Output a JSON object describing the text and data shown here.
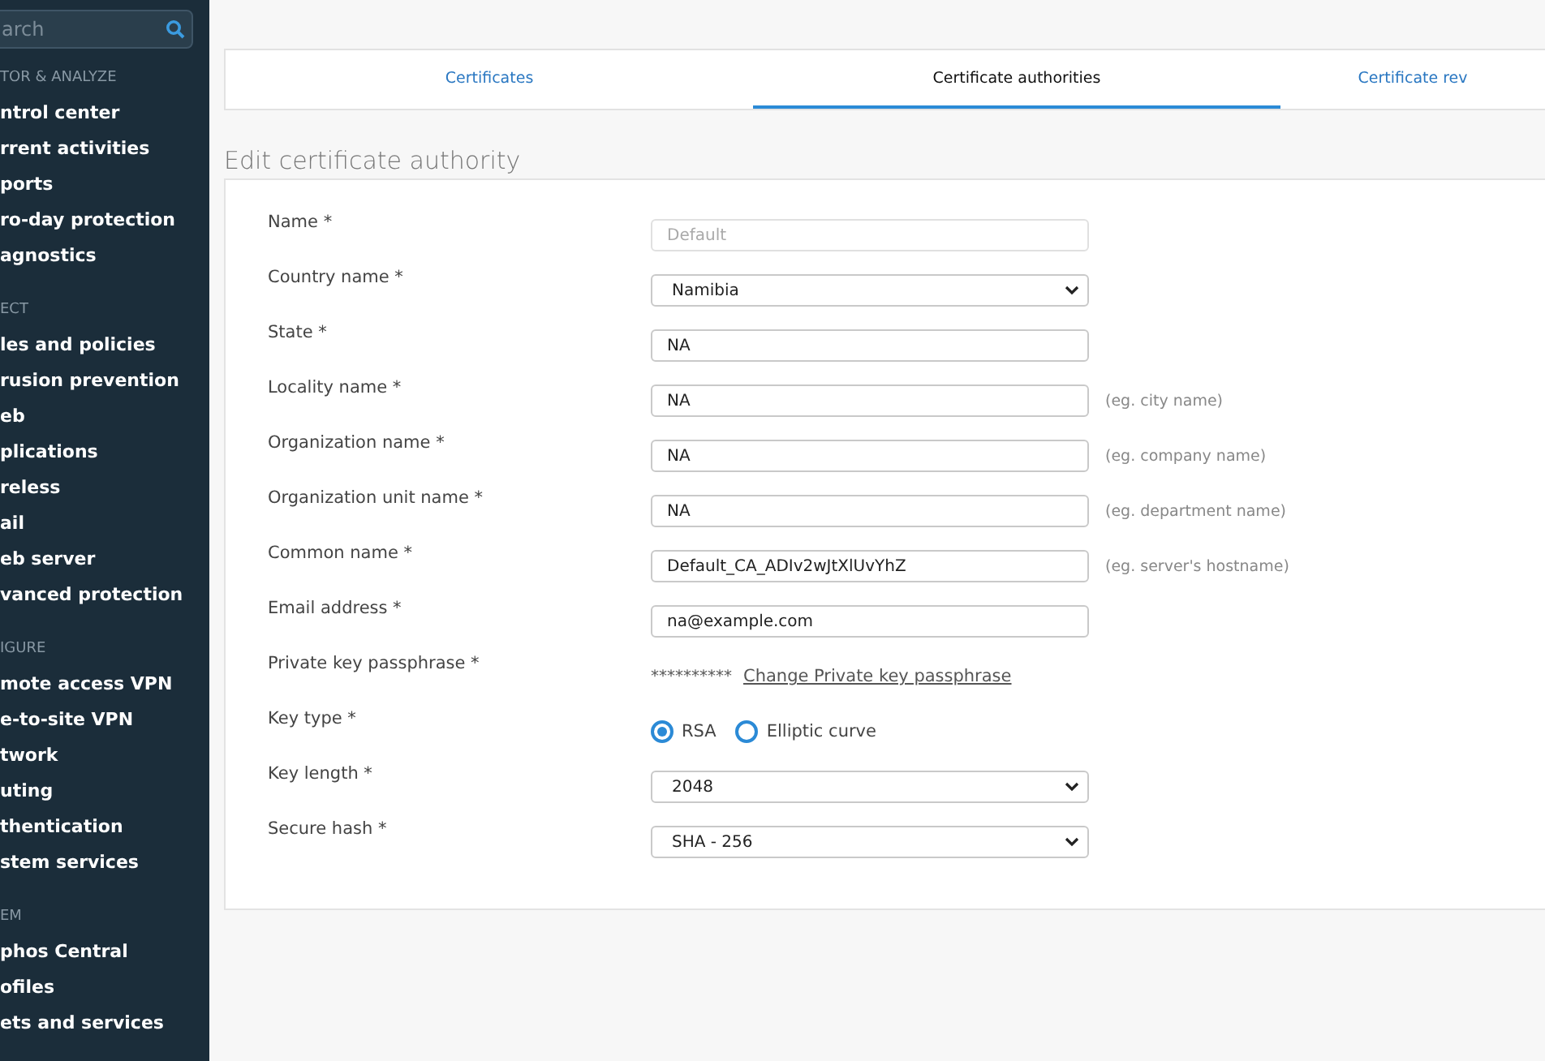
{
  "sidebar": {
    "search": {
      "placeholder": "arch"
    },
    "sections": [
      {
        "title": "TOR & ANALYZE",
        "items": [
          "ntrol center",
          "rrent activities",
          "ports",
          "ro-day protection",
          "agnostics"
        ]
      },
      {
        "title": "ECT",
        "items": [
          "les and policies",
          "rusion prevention",
          "eb",
          "plications",
          "reless",
          "ail",
          "eb server",
          "vanced protection"
        ]
      },
      {
        "title": "IGURE",
        "items": [
          "mote access VPN",
          "e-to-site VPN",
          "twork",
          "uting",
          "thentication",
          "stem services"
        ]
      },
      {
        "title": "EM",
        "items": [
          "phos Central",
          "ofiles",
          "ets and services"
        ]
      }
    ]
  },
  "tabs": [
    {
      "label": "Certificates",
      "selected": false
    },
    {
      "label": "Certificate authorities",
      "selected": true
    },
    {
      "label": "Certificate rev",
      "selected": false
    }
  ],
  "page_title": "Edit certificate authority",
  "form": [
    {
      "kind": "text",
      "label": "Name *",
      "value": "Default",
      "disabled": true
    },
    {
      "kind": "select",
      "label": "Country name *",
      "value": "Namibia"
    },
    {
      "kind": "text",
      "label": "State *",
      "value": "NA",
      "disabled": false
    },
    {
      "kind": "text",
      "label": "Locality name *",
      "value": "NA",
      "disabled": false,
      "hint": "(eg. city name)"
    },
    {
      "kind": "text",
      "label": "Organization name *",
      "value": "NA",
      "disabled": false,
      "hint": "(eg. company name)"
    },
    {
      "kind": "text",
      "label": "Organization unit name *",
      "value": "NA",
      "disabled": false,
      "hint": "(eg. department name)"
    },
    {
      "kind": "text",
      "label": "Common name *",
      "value": "Default_CA_ADIv2wJtXlUvYhZ",
      "disabled": false,
      "hint": "(eg. server's hostname)"
    },
    {
      "kind": "text",
      "label": "Email address *",
      "value": "na@example.com",
      "disabled": false
    },
    {
      "kind": "passphrase",
      "label": "Private key passphrase *",
      "value": "**********",
      "link": "Change Private key passphrase"
    },
    {
      "kind": "radio",
      "label": "Key type *",
      "options": [
        {
          "label": "RSA",
          "selected": true
        },
        {
          "label": "Elliptic curve",
          "selected": false
        }
      ]
    },
    {
      "kind": "select",
      "label": "Key length *",
      "value": "2048"
    },
    {
      "kind": "select",
      "label": "Secure hash *",
      "value": "SHA - 256"
    }
  ]
}
